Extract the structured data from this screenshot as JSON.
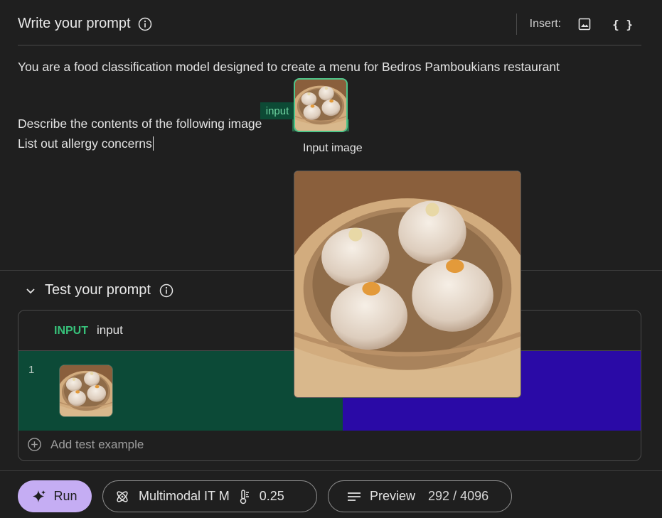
{
  "header": {
    "title": "Write your prompt",
    "insert_label": "Insert:",
    "variable_symbol": "{ }"
  },
  "prompt": {
    "line1": "You are a food classification model designed to create a menu for Bedros Pamboukians restaurant",
    "line2": "Describe the contents of the following image",
    "line3": "List out allergy concerns",
    "variable_tag": "input",
    "popover_label": "Input image"
  },
  "test": {
    "title": "Test your prompt",
    "column_kind": "INPUT",
    "column_name": "input",
    "rows": [
      {
        "number": "1"
      }
    ],
    "add_label": "Add test example"
  },
  "toolbar": {
    "run_label": "Run",
    "model_name": "Multimodal IT M",
    "temperature": "0.25",
    "preview_label": "Preview",
    "token_count": "292 / 4096"
  },
  "colors": {
    "accent_green": "#37c17a",
    "run_button": "#c5adf3",
    "input_cell": "#0c4a37",
    "output_cell": "#2a0aa6"
  },
  "icons": {
    "info": "info-icon",
    "image_insert": "image-icon",
    "chevron": "chevron-down-icon",
    "add": "plus-circle-icon",
    "run": "sparkle-icon",
    "model": "atom-icon",
    "temperature": "thermometer-icon",
    "preview": "lines-icon"
  }
}
